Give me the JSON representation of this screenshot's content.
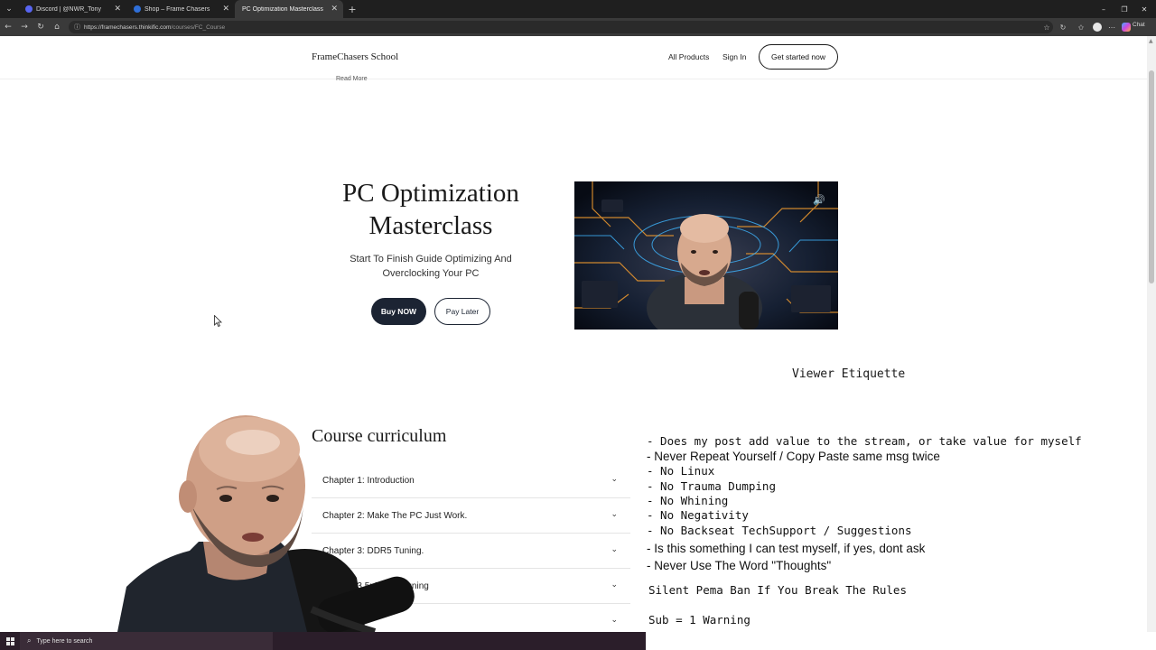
{
  "browser": {
    "tabs": [
      {
        "title": "Discord | @NWR_Tony",
        "favicon_color": "#5865f2",
        "active": false
      },
      {
        "title": "Shop – Frame Chasers",
        "favicon_color": "#2f6fd8",
        "active": false
      },
      {
        "title": "PC Optimization Masterclass",
        "favicon_color": "",
        "active": true
      }
    ],
    "url_host": "https://framechasers.thinkific.com",
    "url_path": "/courses/FC_Course",
    "chat_label": "Chat"
  },
  "site": {
    "brand": "FrameChasers School",
    "nav": {
      "all_products": "All Products",
      "sign_in": "Sign In",
      "cta": "Get started now"
    },
    "read_more": "Read More"
  },
  "hero": {
    "title_line1": "PC Optimization",
    "title_line2": "Masterclass",
    "subtitle_line1": "Start To Finish Guide Optimizing And",
    "subtitle_line2": "Overclocking Your PC",
    "buy_label": "Buy NOW",
    "pay_later_label": "Pay Later"
  },
  "curriculum": {
    "title": "Course curriculum",
    "chapters": [
      "Chapter 1: Introduction",
      "Chapter 2: Make The PC Just Work.",
      "Chapter 3: DDR5 Tuning.",
      "Chapter 3.5: DDR4 Tuning",
      ""
    ]
  },
  "overlay": {
    "title": "Viewer Etiquette",
    "rules": [
      "- Does my post add value to the stream, or take value for myself",
      "- Never Repeat Yourself / Copy Paste same msg twice",
      "- No Linux",
      "- No Trauma Dumping",
      "- No Whining",
      "- No Negativity",
      "- No Backseat TechSupport / Suggestions",
      "- Is this something I can test myself, if yes, dont ask",
      "- Never Use The Word \"Thoughts\""
    ],
    "ban_line": "Silent Pema Ban If You Break The Rules",
    "sub_line": "Sub = 1 Warning"
  },
  "taskbar": {
    "search_placeholder": "Type here to search"
  }
}
